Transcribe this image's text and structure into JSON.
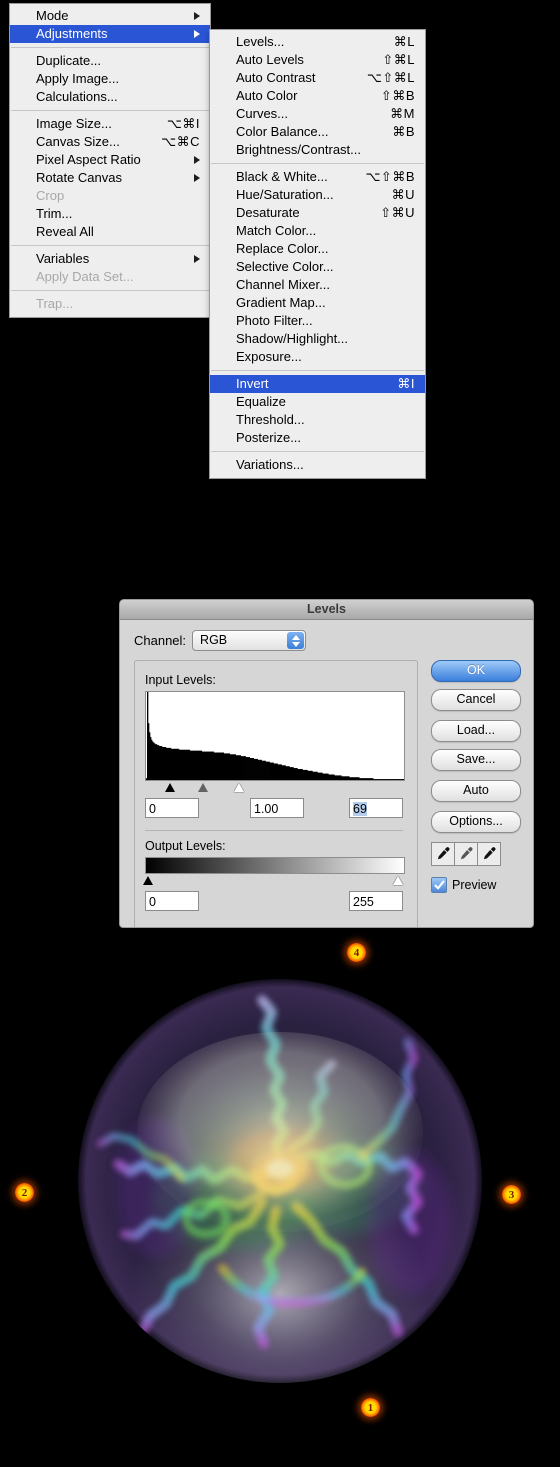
{
  "app": {
    "menu_bar_menu": "Image"
  },
  "image_menu": {
    "name": "Image menu",
    "items": [
      {
        "label": "Mode",
        "shortcut": "",
        "submenu": true,
        "selected": false,
        "disabled": false
      },
      {
        "label": "Adjustments",
        "shortcut": "",
        "submenu": true,
        "selected": true,
        "disabled": false
      },
      {
        "separator": true
      },
      {
        "label": "Duplicate...",
        "shortcut": "",
        "submenu": false,
        "selected": false,
        "disabled": false
      },
      {
        "label": "Apply Image...",
        "shortcut": "",
        "submenu": false,
        "selected": false,
        "disabled": false
      },
      {
        "label": "Calculations...",
        "shortcut": "",
        "submenu": false,
        "selected": false,
        "disabled": false
      },
      {
        "separator": true
      },
      {
        "label": "Image Size...",
        "shortcut": "⌥⌘I",
        "submenu": false,
        "selected": false,
        "disabled": false
      },
      {
        "label": "Canvas Size...",
        "shortcut": "⌥⌘C",
        "submenu": false,
        "selected": false,
        "disabled": false
      },
      {
        "label": "Pixel Aspect Ratio",
        "shortcut": "",
        "submenu": true,
        "selected": false,
        "disabled": false
      },
      {
        "label": "Rotate Canvas",
        "shortcut": "",
        "submenu": true,
        "selected": false,
        "disabled": false
      },
      {
        "label": "Crop",
        "shortcut": "",
        "submenu": false,
        "selected": false,
        "disabled": true
      },
      {
        "label": "Trim...",
        "shortcut": "",
        "submenu": false,
        "selected": false,
        "disabled": false
      },
      {
        "label": "Reveal All",
        "shortcut": "",
        "submenu": false,
        "selected": false,
        "disabled": false
      },
      {
        "separator": true
      },
      {
        "label": "Variables",
        "shortcut": "",
        "submenu": true,
        "selected": false,
        "disabled": false
      },
      {
        "label": "Apply Data Set...",
        "shortcut": "",
        "submenu": false,
        "selected": false,
        "disabled": true
      },
      {
        "separator": true
      },
      {
        "label": "Trap...",
        "shortcut": "",
        "submenu": false,
        "selected": false,
        "disabled": true
      }
    ]
  },
  "adjustments_menu": {
    "name": "Adjustments submenu",
    "items": [
      {
        "label": "Levels...",
        "shortcut": "⌘L",
        "selected": false,
        "disabled": false
      },
      {
        "label": "Auto Levels",
        "shortcut": "⇧⌘L",
        "selected": false,
        "disabled": false
      },
      {
        "label": "Auto Contrast",
        "shortcut": "⌥⇧⌘L",
        "selected": false,
        "disabled": false
      },
      {
        "label": "Auto Color",
        "shortcut": "⇧⌘B",
        "selected": false,
        "disabled": false
      },
      {
        "label": "Curves...",
        "shortcut": "⌘M",
        "selected": false,
        "disabled": false
      },
      {
        "label": "Color Balance...",
        "shortcut": "⌘B",
        "selected": false,
        "disabled": false
      },
      {
        "label": "Brightness/Contrast...",
        "shortcut": "",
        "selected": false,
        "disabled": false
      },
      {
        "separator": true
      },
      {
        "label": "Black & White...",
        "shortcut": "⌥⇧⌘B",
        "selected": false,
        "disabled": false
      },
      {
        "label": "Hue/Saturation...",
        "shortcut": "⌘U",
        "selected": false,
        "disabled": false
      },
      {
        "label": "Desaturate",
        "shortcut": "⇧⌘U",
        "selected": false,
        "disabled": false
      },
      {
        "label": "Match Color...",
        "shortcut": "",
        "selected": false,
        "disabled": false
      },
      {
        "label": "Replace Color...",
        "shortcut": "",
        "selected": false,
        "disabled": false
      },
      {
        "label": "Selective Color...",
        "shortcut": "",
        "selected": false,
        "disabled": false
      },
      {
        "label": "Channel Mixer...",
        "shortcut": "",
        "selected": false,
        "disabled": false
      },
      {
        "label": "Gradient Map...",
        "shortcut": "",
        "selected": false,
        "disabled": false
      },
      {
        "label": "Photo Filter...",
        "shortcut": "",
        "selected": false,
        "disabled": false
      },
      {
        "label": "Shadow/Highlight...",
        "shortcut": "",
        "selected": false,
        "disabled": false
      },
      {
        "label": "Exposure...",
        "shortcut": "",
        "selected": false,
        "disabled": false
      },
      {
        "separator": true
      },
      {
        "label": "Invert",
        "shortcut": "⌘I",
        "selected": true,
        "disabled": false
      },
      {
        "label": "Equalize",
        "shortcut": "",
        "selected": false,
        "disabled": false
      },
      {
        "label": "Threshold...",
        "shortcut": "",
        "selected": false,
        "disabled": false
      },
      {
        "label": "Posterize...",
        "shortcut": "",
        "selected": false,
        "disabled": false
      },
      {
        "separator": true
      },
      {
        "label": "Variations...",
        "shortcut": "",
        "selected": false,
        "disabled": false
      }
    ]
  },
  "levels_dialog": {
    "title": "Levels",
    "channel_label": "Channel:",
    "channel_value": "RGB",
    "input_levels_label": "Input Levels:",
    "output_levels_label": "Output Levels:",
    "input_shadow": "0",
    "input_gamma": "1.00",
    "input_highlight": "69",
    "input_highlight_selected": true,
    "output_shadow": "0",
    "output_highlight": "255",
    "buttons": {
      "ok": "OK",
      "cancel": "Cancel",
      "load": "Load...",
      "save": "Save...",
      "auto": "Auto",
      "options": "Options..."
    },
    "eyedroppers": [
      "set-black-point-eyedropper",
      "set-gray-point-eyedropper",
      "set-white-point-eyedropper"
    ],
    "preview_label": "Preview",
    "preview_checked": true,
    "accent_color": "#3b7edc",
    "selection_color": "#b4ccec"
  },
  "histogram": {
    "description": "Input levels histogram of a predominantly dark image: tall narrow spike at the far left shadows, then a long shallow ramp falling off toward the highlights and reaching zero near the right edge.",
    "bins": [
      2,
      96,
      62,
      52,
      47,
      44,
      42,
      41,
      40,
      39,
      39,
      38,
      38,
      37,
      37,
      37,
      36,
      36,
      36,
      36,
      35,
      35,
      35,
      35,
      35,
      34,
      34,
      34,
      34,
      34,
      34,
      34,
      34,
      33,
      33,
      33,
      33,
      33,
      33,
      33,
      33,
      33,
      33,
      33,
      32,
      32,
      32,
      32,
      32,
      32,
      32,
      32,
      32,
      32,
      32,
      32,
      31,
      31,
      31,
      31,
      31,
      31,
      31,
      31,
      31,
      31,
      31,
      31,
      30,
      30,
      30,
      30,
      30,
      30,
      30,
      30,
      30,
      30,
      29,
      29,
      29,
      29,
      29,
      29,
      28,
      28,
      28,
      28,
      28,
      28,
      27,
      27,
      27,
      27,
      27,
      26,
      26,
      26,
      26,
      26,
      25,
      25,
      25,
      25,
      24,
      24,
      24,
      24,
      23,
      23,
      23,
      23,
      22,
      22,
      22,
      22,
      21,
      21,
      21,
      21,
      20,
      20,
      20,
      20,
      19,
      19,
      19,
      19,
      18,
      18,
      18,
      18,
      17,
      17,
      17,
      17,
      16,
      16,
      16,
      16,
      15,
      15,
      15,
      15,
      14,
      14,
      14,
      14,
      13,
      13,
      13,
      13,
      12,
      12,
      12,
      12,
      12,
      11,
      11,
      11,
      11,
      11,
      10,
      10,
      10,
      10,
      10,
      9,
      9,
      9,
      9,
      9,
      8,
      8,
      8,
      8,
      8,
      7,
      7,
      7,
      7,
      7,
      7,
      6,
      6,
      6,
      6,
      6,
      6,
      5,
      5,
      5,
      5,
      5,
      5,
      5,
      4,
      4,
      4,
      4,
      4,
      4,
      4,
      4,
      3,
      3,
      3,
      3,
      3,
      3,
      3,
      3,
      3,
      3,
      2,
      2,
      2,
      2,
      2,
      2,
      2,
      2,
      2,
      2,
      2,
      2,
      2,
      2,
      1,
      1,
      1,
      1,
      1,
      1,
      1,
      1,
      1,
      1,
      1,
      1,
      1,
      1,
      1,
      1,
      1,
      1,
      1,
      1,
      1,
      1,
      1,
      1,
      1,
      1,
      1,
      1,
      1,
      1,
      1
    ]
  },
  "plasma_image": {
    "description": "Circular plasma-globe photograph: rainbow-colored branching lightning filaments radiate from a bright yellow-orange core outward through green, cyan, blue and violet toward the rim; a soft pale elliptical reflection sits over the upper portion and a diffuse white glow at the lower edge.",
    "center_color": "#ffd24a",
    "mid_color": "#5ee07a",
    "outer_color": "#7a3ec8"
  },
  "markers": [
    {
      "label": "1",
      "name": "callout-marker-1"
    },
    {
      "label": "2",
      "name": "callout-marker-2"
    },
    {
      "label": "3",
      "name": "callout-marker-3"
    },
    {
      "label": "4",
      "name": "callout-marker-4"
    }
  ]
}
